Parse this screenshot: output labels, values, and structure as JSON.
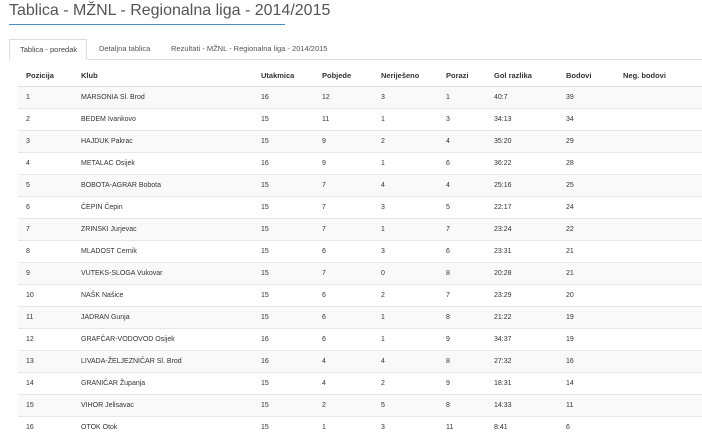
{
  "page": {
    "title": "Tablica - MŽNL - Regionalna liga - 2014/2015"
  },
  "tabs": [
    {
      "label": "Tablica - poredak",
      "active": true
    },
    {
      "label": "Detaljna tablica",
      "active": false
    },
    {
      "label": "Rezultati - MŽNL - Regionalna liga - 2014/2015",
      "active": false
    }
  ],
  "table": {
    "headers": [
      "Pozicija",
      "Klub",
      "Utakmica",
      "Pobjede",
      "Neriješeno",
      "Porazi",
      "Gol razlika",
      "Bodovi",
      "Neg. bodovi"
    ],
    "rows": [
      [
        "1",
        "MARSONIA Sl. Brod",
        "16",
        "12",
        "3",
        "1",
        "40:7",
        "39",
        ""
      ],
      [
        "2",
        "BEDEM Ivankovo",
        "15",
        "11",
        "1",
        "3",
        "34:13",
        "34",
        ""
      ],
      [
        "3",
        "HAJDUK Pakrac",
        "15",
        "9",
        "2",
        "4",
        "35:20",
        "29",
        ""
      ],
      [
        "4",
        "METALAC Osijek",
        "16",
        "9",
        "1",
        "6",
        "36:22",
        "28",
        ""
      ],
      [
        "5",
        "BOBOTA-AGRAR Bobota",
        "15",
        "7",
        "4",
        "4",
        "25:16",
        "25",
        ""
      ],
      [
        "6",
        "ČEPIN Čepin",
        "15",
        "7",
        "3",
        "5",
        "22:17",
        "24",
        ""
      ],
      [
        "7",
        "ZRINSKI Jurjevac",
        "15",
        "7",
        "1",
        "7",
        "23:24",
        "22",
        ""
      ],
      [
        "8",
        "MLADOST Cernik",
        "15",
        "6",
        "3",
        "6",
        "23:31",
        "21",
        ""
      ],
      [
        "9",
        "VUTEKS-SLOGA Vukovar",
        "15",
        "7",
        "0",
        "8",
        "20:28",
        "21",
        ""
      ],
      [
        "10",
        "NAŠK Našice",
        "15",
        "6",
        "2",
        "7",
        "23:29",
        "20",
        ""
      ],
      [
        "11",
        "JADRAN Gunja",
        "15",
        "6",
        "1",
        "8",
        "21:22",
        "19",
        ""
      ],
      [
        "12",
        "GRAFČAR-VODOVOD Osijek",
        "16",
        "6",
        "1",
        "9",
        "34:37",
        "19",
        ""
      ],
      [
        "13",
        "LIVADA-ŽELJEZNIČAR Sl. Brod",
        "16",
        "4",
        "4",
        "8",
        "27:32",
        "16",
        ""
      ],
      [
        "14",
        "GRANIČAR Županja",
        "15",
        "4",
        "2",
        "9",
        "18:31",
        "14",
        ""
      ],
      [
        "15",
        "VIHOR Jelisavac",
        "15",
        "2",
        "5",
        "8",
        "14:33",
        "11",
        ""
      ],
      [
        "16",
        "OTOK Otok",
        "15",
        "1",
        "3",
        "11",
        "8:41",
        "6",
        ""
      ]
    ]
  },
  "colors": {
    "accent": "#4a90c7",
    "row_stripe": "#f9f9f9",
    "border": "#dddddd"
  }
}
